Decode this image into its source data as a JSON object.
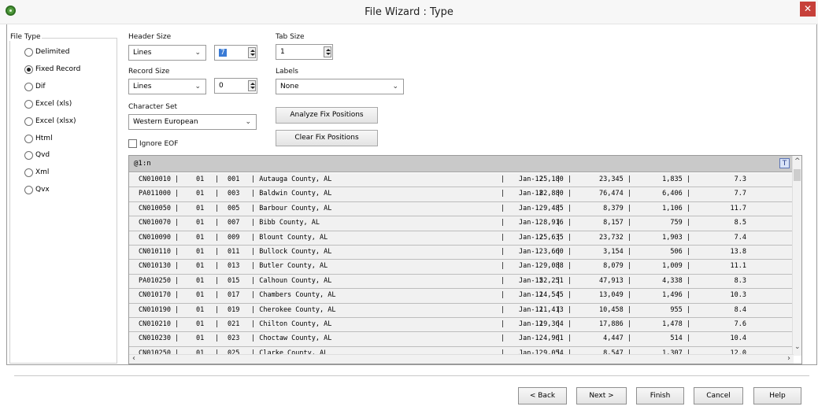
{
  "window": {
    "title": "File Wizard : Type",
    "close_glyph": "✕"
  },
  "file_type": {
    "label": "File Type",
    "options": [
      "Delimited",
      "Fixed Record",
      "Dif",
      "Excel (xls)",
      "Excel (xlsx)",
      "Html",
      "Qvd",
      "Xml",
      "Qvx"
    ],
    "selected": "Fixed Record"
  },
  "header_size": {
    "label": "Header Size",
    "unit": "Lines",
    "value": "7"
  },
  "tab_size": {
    "label": "Tab Size",
    "value": "1"
  },
  "record_size": {
    "label": "Record Size",
    "unit": "Lines",
    "value": "0"
  },
  "labels": {
    "label": "Labels",
    "value": "None"
  },
  "character_set": {
    "label": "Character Set",
    "value": "Western European"
  },
  "buttons": {
    "analyze": "Analyze Fix Positions",
    "clear": "Clear Fix Positions"
  },
  "ignore_eof": {
    "label": "Ignore EOF",
    "checked": false
  },
  "grid": {
    "header": "@1:n",
    "t_icon": "T",
    "rows": [
      [
        "CN010010 |",
        "01",
        "|",
        "001",
        "| Autauga County, AL",
        "|",
        "Jan-12",
        "|",
        "25,180 |",
        "23,345 |",
        "1,835 |",
        "7.3"
      ],
      [
        "PA011000 |",
        "01",
        "|",
        "003",
        "| Baldwin County, AL",
        "|",
        "Jan-12",
        "|",
        "82,880 |",
        "76,474 |",
        "6,406 |",
        "7.7"
      ],
      [
        "CN010050 |",
        "01",
        "|",
        "005",
        "| Barbour County, AL",
        "|",
        "Jan-12",
        "|",
        "9,485 |",
        "8,379 |",
        "1,106 |",
        "11.7"
      ],
      [
        "CN010070 |",
        "01",
        "|",
        "007",
        "| Bibb County, AL",
        "|",
        "Jan-12",
        "|",
        "8,916 |",
        "8,157 |",
        "759 |",
        "8.5"
      ],
      [
        "CN010090 |",
        "01",
        "|",
        "009",
        "| Blount County, AL",
        "|",
        "Jan-12",
        "|",
        "25,635 |",
        "23,732 |",
        "1,903 |",
        "7.4"
      ],
      [
        "CN010110 |",
        "01",
        "|",
        "011",
        "| Bullock County, AL",
        "|",
        "Jan-12",
        "|",
        "3,660 |",
        "3,154 |",
        "506 |",
        "13.8"
      ],
      [
        "CN010130 |",
        "01",
        "|",
        "013",
        "| Butler County, AL",
        "|",
        "Jan-12",
        "|",
        "9,088 |",
        "8,079 |",
        "1,009 |",
        "11.1"
      ],
      [
        "PA010250 |",
        "01",
        "|",
        "015",
        "| Calhoun County, AL",
        "|",
        "Jan-12",
        "|",
        "52,251 |",
        "47,913 |",
        "4,338 |",
        "8.3"
      ],
      [
        "CN010170 |",
        "01",
        "|",
        "017",
        "| Chambers County, AL",
        "|",
        "Jan-12",
        "|",
        "14,545 |",
        "13,049 |",
        "1,496 |",
        "10.3"
      ],
      [
        "CN010190 |",
        "01",
        "|",
        "019",
        "| Cherokee County, AL",
        "|",
        "Jan-12",
        "|",
        "11,413 |",
        "10,458 |",
        "955 |",
        "8.4"
      ],
      [
        "CN010210 |",
        "01",
        "|",
        "021",
        "| Chilton County, AL",
        "|",
        "Jan-12",
        "|",
        "19,364 |",
        "17,886 |",
        "1,478 |",
        "7.6"
      ],
      [
        "CN010230 |",
        "01",
        "|",
        "023",
        "| Choctaw County, AL",
        "|",
        "Jan-12",
        "|",
        "4,961 |",
        "4,447 |",
        "514 |",
        "10.4"
      ],
      [
        "CN010250 |",
        "01",
        "|",
        "025",
        "| Clarke County, AL",
        "|",
        "Jan-12",
        "|",
        "9,054 |",
        "8,547 |",
        "1,307 |",
        "12.0"
      ]
    ]
  },
  "footer": {
    "back": "< Back",
    "next": "Next >",
    "finish": "Finish",
    "cancel": "Cancel",
    "help": "Help"
  },
  "icons": {
    "app": "qlikview-icon",
    "close": "close-icon"
  }
}
